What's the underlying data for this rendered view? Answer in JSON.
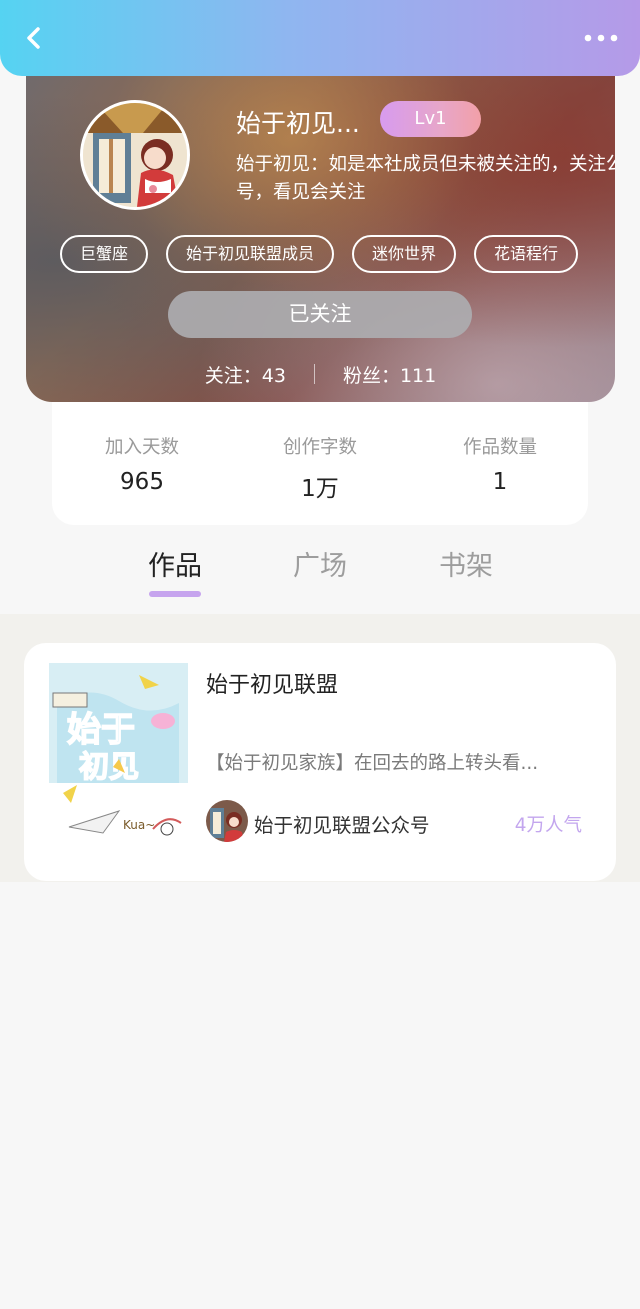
{
  "header": {
    "back_icon": "chevron-left-icon",
    "more_icon": "more-dots-icon"
  },
  "profile": {
    "nickname": "始于初见...",
    "level": "Lv1",
    "bio": "始于初见：如是本社成员但未被关注的，关注公众号，看见会关注",
    "tags": [
      "巨蟹座",
      "始于初见联盟成员",
      "迷你世界",
      "花语程行"
    ],
    "follow_button": "已关注",
    "following": "关注：43",
    "fans": "粉丝：111"
  },
  "stats": [
    {
      "label": "加入天数",
      "value": "965"
    },
    {
      "label": "创作字数",
      "value": "1万"
    },
    {
      "label": "作品数量",
      "value": "1"
    }
  ],
  "tabs": [
    {
      "label": "作品",
      "active": true
    },
    {
      "label": "广场",
      "active": false
    },
    {
      "label": "书架",
      "active": false
    }
  ],
  "works": [
    {
      "title": "始于初见联盟",
      "description": "【始于初见家族】在回去的路上转头看...",
      "author": "始于初见联盟公众号",
      "popularity": "4万人气"
    }
  ],
  "colors": {
    "accent": "#c6a4ee",
    "popularity": "#c3a6ee",
    "badge": "#e3a3d6"
  }
}
